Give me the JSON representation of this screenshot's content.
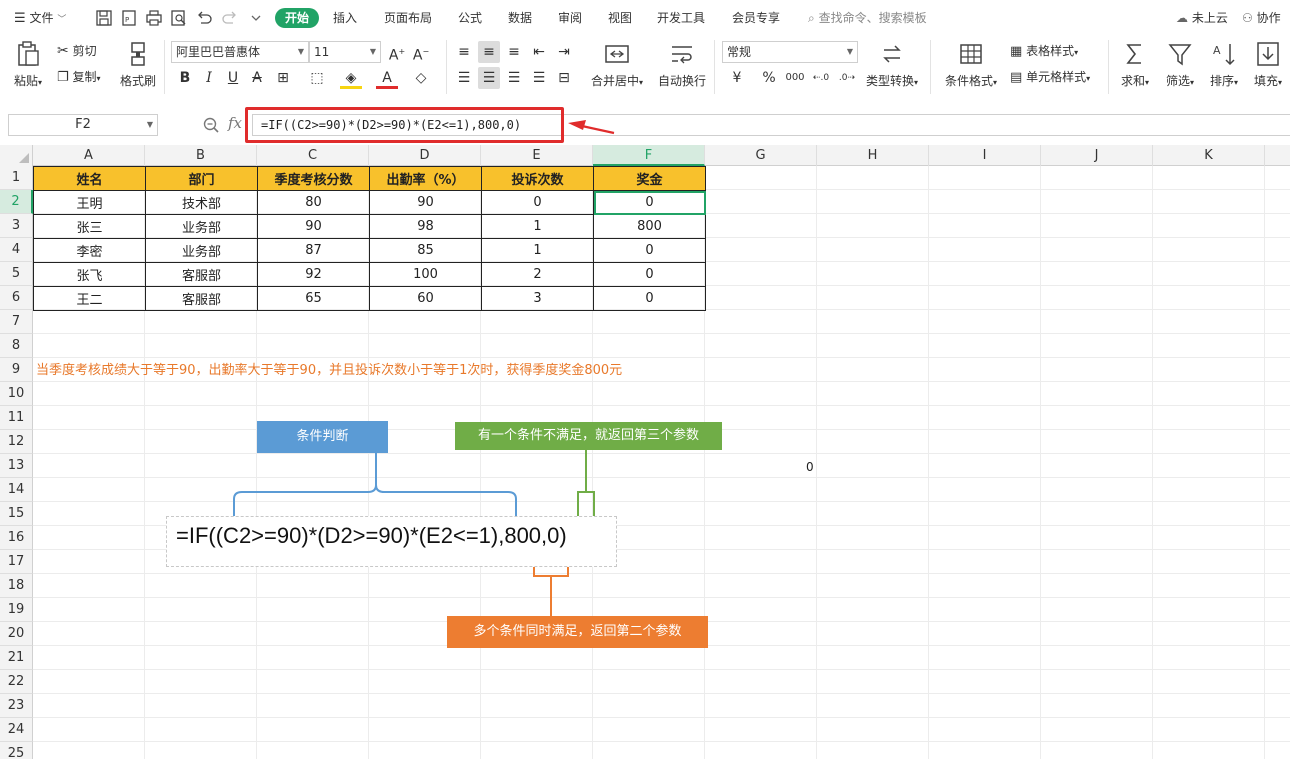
{
  "menu": {
    "file_label": "文件",
    "tabs": [
      {
        "label": "开始",
        "active": true
      },
      {
        "label": "插入"
      },
      {
        "label": "页面布局"
      },
      {
        "label": "公式"
      },
      {
        "label": "数据"
      },
      {
        "label": "审阅"
      },
      {
        "label": "视图"
      },
      {
        "label": "开发工具"
      },
      {
        "label": "会员专享"
      }
    ],
    "search_placeholder": "查找命令、搜索模板",
    "cloud_status": "未上云",
    "collab_label": "协作"
  },
  "ribbon": {
    "paste": "粘贴",
    "cut": "剪切",
    "copy": "复制",
    "format_painter": "格式刷",
    "font_name": "阿里巴巴普惠体",
    "font_size": "11",
    "merge_center": "合并居中",
    "wrap_text": "自动换行",
    "number_format": "常规",
    "type_convert": "类型转换",
    "conditional_format": "条件格式",
    "table_style": "表格样式",
    "cell_style": "单元格样式",
    "sum": "求和",
    "filter": "筛选",
    "sort": "排序",
    "fill": "填充",
    "currency_symbol": "¥",
    "percent_symbol": "%",
    "thousands_symbol": "000"
  },
  "formula_bar": {
    "cell_ref": "F2",
    "fx": "fx",
    "formula": "=IF((C2>=90)*(D2>=90)*(E2<=1),800,0)"
  },
  "columns": [
    "A",
    "B",
    "C",
    "D",
    "E",
    "F",
    "G",
    "H",
    "I",
    "J",
    "K"
  ],
  "active_column": "F",
  "rows": [
    "1",
    "2",
    "3",
    "4",
    "5",
    "6",
    "7",
    "8",
    "9",
    "10",
    "11",
    "12",
    "13",
    "14",
    "15",
    "16",
    "17",
    "18",
    "19",
    "20",
    "21",
    "22",
    "23",
    "24",
    "25"
  ],
  "active_row": "2",
  "table": {
    "headers": [
      "姓名",
      "部门",
      "季度考核分数",
      "出勤率（%）",
      "投诉次数",
      "奖金"
    ],
    "rows": [
      [
        "王明",
        "技术部",
        "80",
        "90",
        "0",
        "0"
      ],
      [
        "张三",
        "业务部",
        "90",
        "98",
        "1",
        "800"
      ],
      [
        "李密",
        "业务部",
        "87",
        "85",
        "1",
        "0"
      ],
      [
        "张飞",
        "客服部",
        "92",
        "100",
        "2",
        "0"
      ],
      [
        "王二",
        "客服部",
        "65",
        "60",
        "3",
        "0"
      ]
    ]
  },
  "note": "当季度考核成绩大于等于90，出勤率大于等于90，并且投诉次数小于等于1次时，获得季度奖金800元",
  "stray_value": "0",
  "annotation": {
    "condition_label": "条件判断",
    "false_label": "有一个条件不满足，就返回第三个参数",
    "true_label": "多个条件同时满足，返回第二个参数",
    "formula": "=IF((C2>=90)*(D2>=90)*(E2<=1),800,0)"
  },
  "colors": {
    "accent_green": "#21a366",
    "header_fill": "#f8c12c",
    "note_orange": "#e8792b",
    "callout_blue": "#5b9bd5",
    "callout_green": "#70ad47",
    "callout_orange": "#ed7d31",
    "highlight_red": "#e02c2c"
  }
}
